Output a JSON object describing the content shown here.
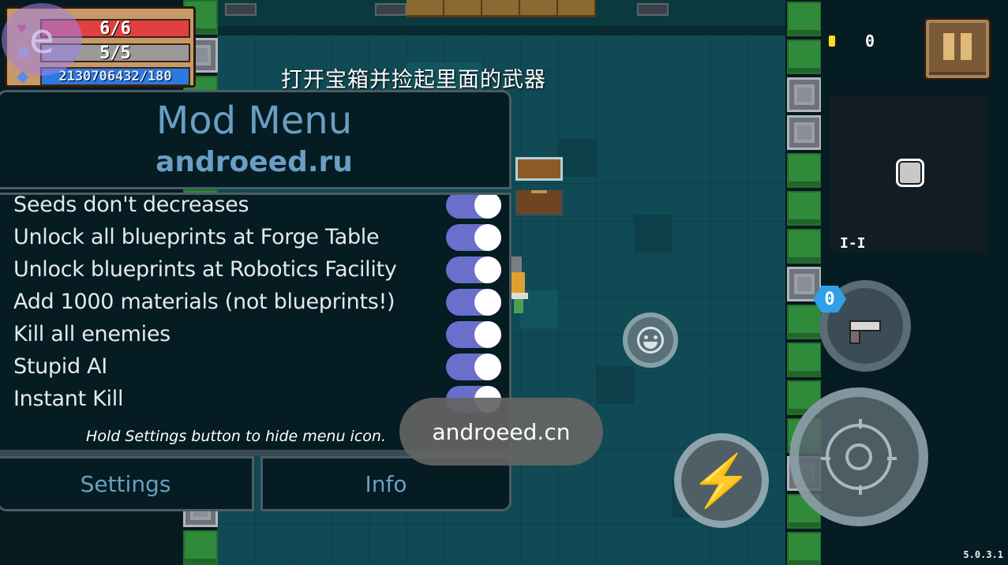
{
  "hud": {
    "hp": "6/6",
    "armor": "5/5",
    "energy": "2130706432/180",
    "coins": "0",
    "energy_cost": "0",
    "hint": "打开宝箱并捡起里面的武器",
    "version": "5.0.3.1",
    "overlay_badge": "e",
    "minimap_marker": "I-I",
    "icons": {
      "hp": "heart-icon",
      "armor": "shield-icon",
      "energy": "gem-icon",
      "coin": "coin-icon",
      "pause": "pause-icon",
      "skill": "lightning-icon",
      "emote": "smiley-icon",
      "attack": "crosshair-icon",
      "weapon": "pistol-icon"
    },
    "colors": {
      "hp": "#e04040",
      "armor": "#9a9a9a",
      "energy": "#2a7ae0",
      "coin": "#f5e020"
    }
  },
  "mod_menu": {
    "title": "Mod Menu",
    "subtitle": "androeed.ru",
    "items": [
      {
        "label": "Seeds don't decreases",
        "enabled": true
      },
      {
        "label": "Unlock all blueprints at Forge Table",
        "enabled": true
      },
      {
        "label": "Unlock blueprints at Robotics Facility",
        "enabled": true
      },
      {
        "label": "Add 1000 materials (not blueprints!)",
        "enabled": true
      },
      {
        "label": "Kill all enemies",
        "enabled": true
      },
      {
        "label": "Stupid AI",
        "enabled": true
      },
      {
        "label": "Instant Kill",
        "enabled": true
      }
    ],
    "note": "Hold Settings button to hide menu icon.",
    "settings_label": "Settings",
    "info_label": "Info",
    "colors": {
      "accent_text": "#6a9ec4",
      "switch_on": "#6a6fcc",
      "background": "#041c22"
    }
  },
  "toast": {
    "text": "androeed.cn"
  }
}
